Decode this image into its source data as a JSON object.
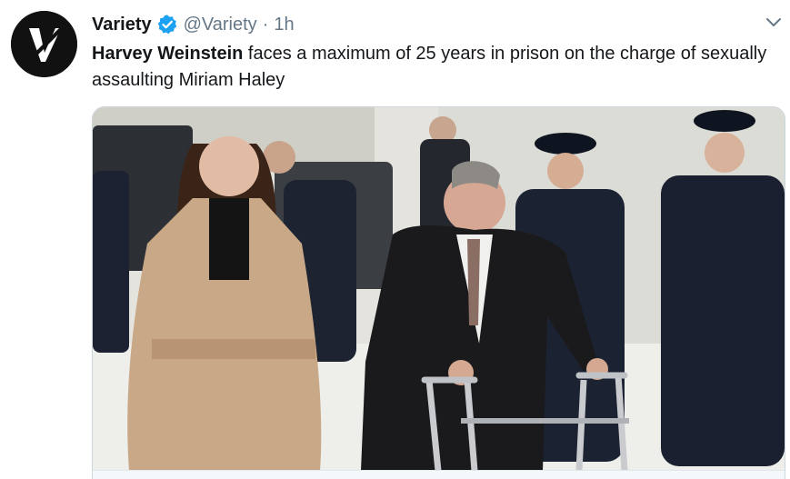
{
  "account": {
    "display_name": "Variety",
    "handle": "@Variety",
    "separator": "·",
    "time": "1h",
    "avatar_icon": "variety-v-logo",
    "verified_icon": "verified-badge-icon"
  },
  "tweet": {
    "text_bold": "Harvey Weinstein",
    "text_rest": " faces a maximum of 25 years in prison on the charge of sexually assaulting Miriam Haley"
  },
  "media": {
    "kind": "photo"
  },
  "colors": {
    "secondary_text": "#657786",
    "verified_blue": "#1da1f2",
    "border": "#ccd6dd"
  }
}
